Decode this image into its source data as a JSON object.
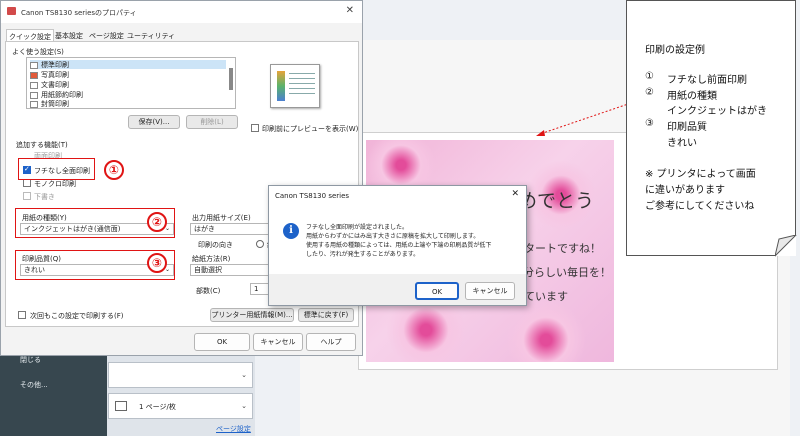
{
  "props_dialog": {
    "title": "Canon TS8130 seriesのプロパティ",
    "close_glyph": "✕",
    "tabs": [
      "クイック設定",
      "基本設定",
      "ページ設定",
      "ユーティリティ"
    ],
    "favorites_label": "よく使う設定(S)",
    "favorites": [
      "標準印刷",
      "写真印刷",
      "文書印刷",
      "用紙節約印刷",
      "封筒印刷"
    ],
    "save_button": "保存(V)...",
    "delete_button": "削除(L)",
    "preview_checkbox": "印刷前にプレビューを表示(W)",
    "features_label": "追加する機能(T)",
    "features": [
      {
        "label": "両面印刷",
        "checked": false
      },
      {
        "label": "フチなし全面印刷",
        "checked": true
      },
      {
        "label": "モノクロ印刷",
        "checked": false
      },
      {
        "label": "下書き",
        "checked": false
      }
    ],
    "media_type_label": "用紙の種類(Y)",
    "media_type_value": "インクジェットはがき(通信面)",
    "print_quality_label": "印刷品質(Q)",
    "print_quality_value": "きれい",
    "output_size_label": "出力用紙サイズ(E)",
    "output_size_value": "はがき",
    "orientation_label": "印刷の向き",
    "orientation_value": "縦",
    "paper_source_label": "給紙方法(R)",
    "paper_source_value": "自動選択",
    "copies_label": "部数(C)",
    "copies_value": "1",
    "always_print_checkbox": "次回もこの設定で印刷する(F)",
    "printer_info_button": "プリンター用紙情報(M)...",
    "defaults_button": "標準に戻す(F)",
    "ok_button": "OK",
    "cancel_button": "キャンセル",
    "help_button": "ヘルプ"
  },
  "markers": [
    "①",
    "②",
    "③"
  ],
  "message_box": {
    "title": "Canon TS8130 series",
    "close_glyph": "✕",
    "icon_glyph": "i",
    "lines": [
      "フチなし全面印刷が設定されました。",
      "用紙からわずかにはみ出す大きさに原稿を拡大して印刷します。",
      "使用する用紙の種類によっては、用紙の上端や下端の印刷品質が低下",
      "したり、汚れが発生することがあります。"
    ],
    "ok_button": "OK",
    "cancel_button": "キャンセル"
  },
  "background_app": {
    "nav_items": [
      "閉じる",
      "その他..."
    ],
    "layout_combo": "1 ページ/枚",
    "page_setup_link": "ページ設定",
    "card_text": [
      "めでとう",
      "タートですね！",
      "自分らしい毎日を！",
      "ています"
    ]
  },
  "note": {
    "title": "印刷の設定例",
    "items": [
      {
        "num": "①",
        "text": "フチなし前面印刷"
      },
      {
        "num": "②",
        "text": "用紙の種類"
      },
      {
        "num": "",
        "text": "インクジェットはがき"
      },
      {
        "num": "③",
        "text": "印刷品質"
      },
      {
        "num": "",
        "text": "きれい"
      }
    ],
    "footer": [
      "※ プリンタによって画面",
      "に違いがあります",
      "ご参考にしてくださいね"
    ]
  },
  "colors": {
    "accent": "#1d62c9",
    "marker": "#e01414",
    "card": "#f1b4d8"
  }
}
